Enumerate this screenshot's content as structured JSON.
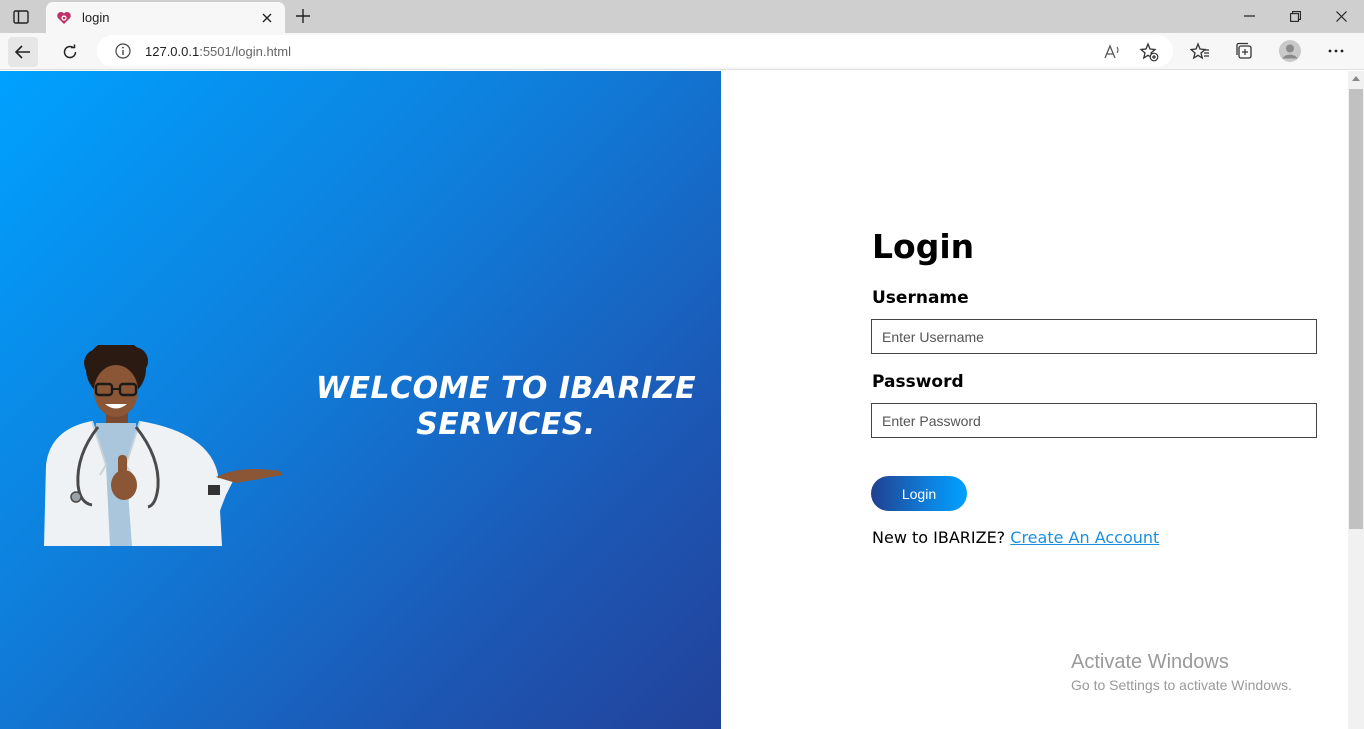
{
  "browser": {
    "tab_title": "login",
    "url_host": "127.0.0.1",
    "url_rest": ":5501/login.html"
  },
  "hero": {
    "welcome_line1": "WELCOME TO IBARIZE",
    "welcome_line2": "SERVICES."
  },
  "login": {
    "title": "Login",
    "username_label": "Username",
    "username_placeholder": "Enter Username",
    "password_label": "Password",
    "password_placeholder": "Enter Password",
    "button_label": "Login",
    "signup_prompt": "New to IBARIZE?",
    "signup_link": "Create An Account"
  },
  "watermark": {
    "title": "Activate Windows",
    "subtitle": "Go to Settings to activate Windows."
  },
  "colors": {
    "hero_start": "#00a1ff",
    "hero_end": "#22429a",
    "link": "#1a8fe0"
  }
}
